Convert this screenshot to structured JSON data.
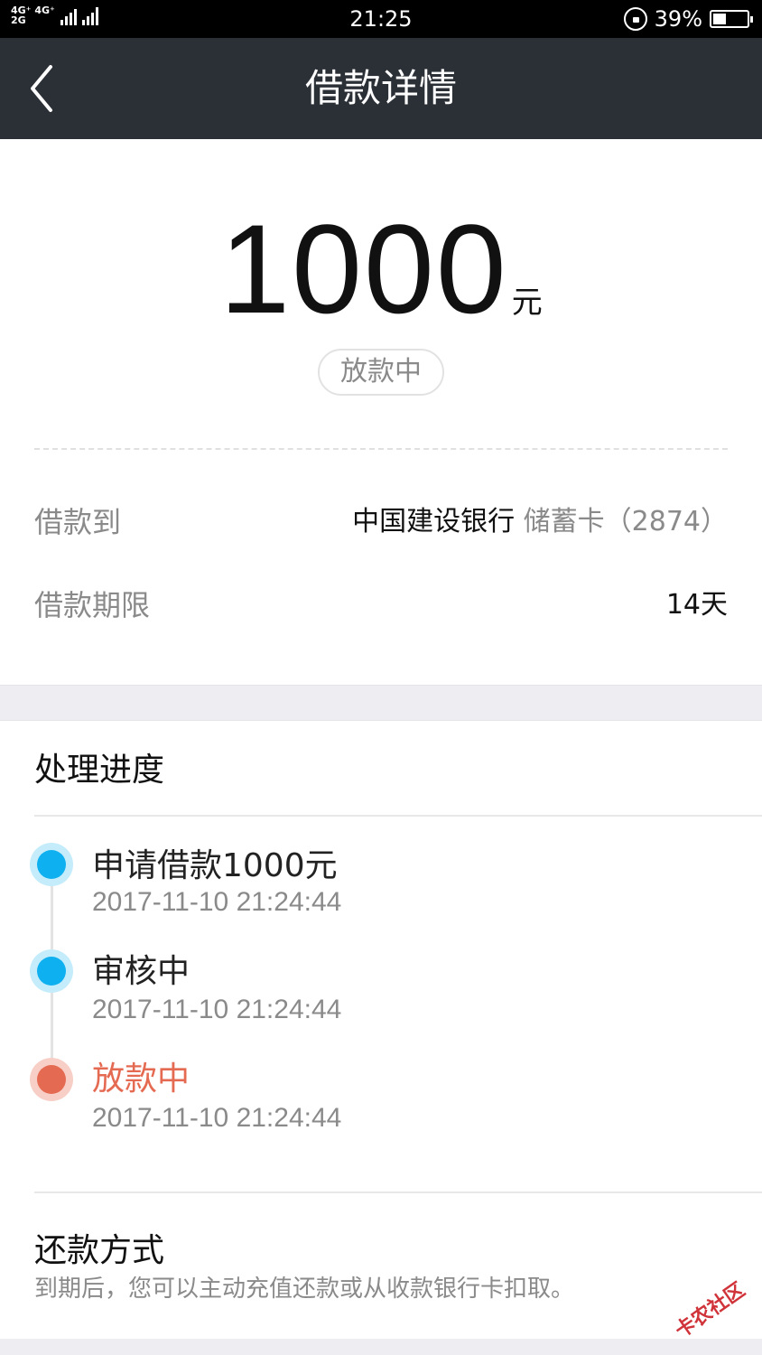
{
  "status_bar": {
    "network_top": "4G⁺ 4G⁺",
    "network_bottom": "2G",
    "time": "21:25",
    "battery": "39%"
  },
  "nav": {
    "title": "借款详情"
  },
  "loan": {
    "amount": "1000",
    "unit": "元",
    "status": "放款中"
  },
  "info": {
    "to_label": "借款到",
    "bank_name": "中国建设银行",
    "card_info": "储蓄卡（2874）",
    "term_label": "借款期限",
    "term_value": "14天"
  },
  "progress": {
    "title": "处理进度",
    "steps": [
      {
        "title": "申请借款1000元",
        "time": "2017-11-10 21:24:44"
      },
      {
        "title": "审核中",
        "time": "2017-11-10 21:24:44"
      },
      {
        "title": "放款中",
        "time": "2017-11-10 21:24:44"
      }
    ]
  },
  "repay": {
    "title": "还款方式",
    "description": "到期后，您可以主动充值还款或从收款银行卡扣取。"
  },
  "watermark": "卡农社区",
  "colors": {
    "nav_bg": "#2b2f36",
    "step_done": "#0fb0f0",
    "step_current": "#e56a52"
  }
}
